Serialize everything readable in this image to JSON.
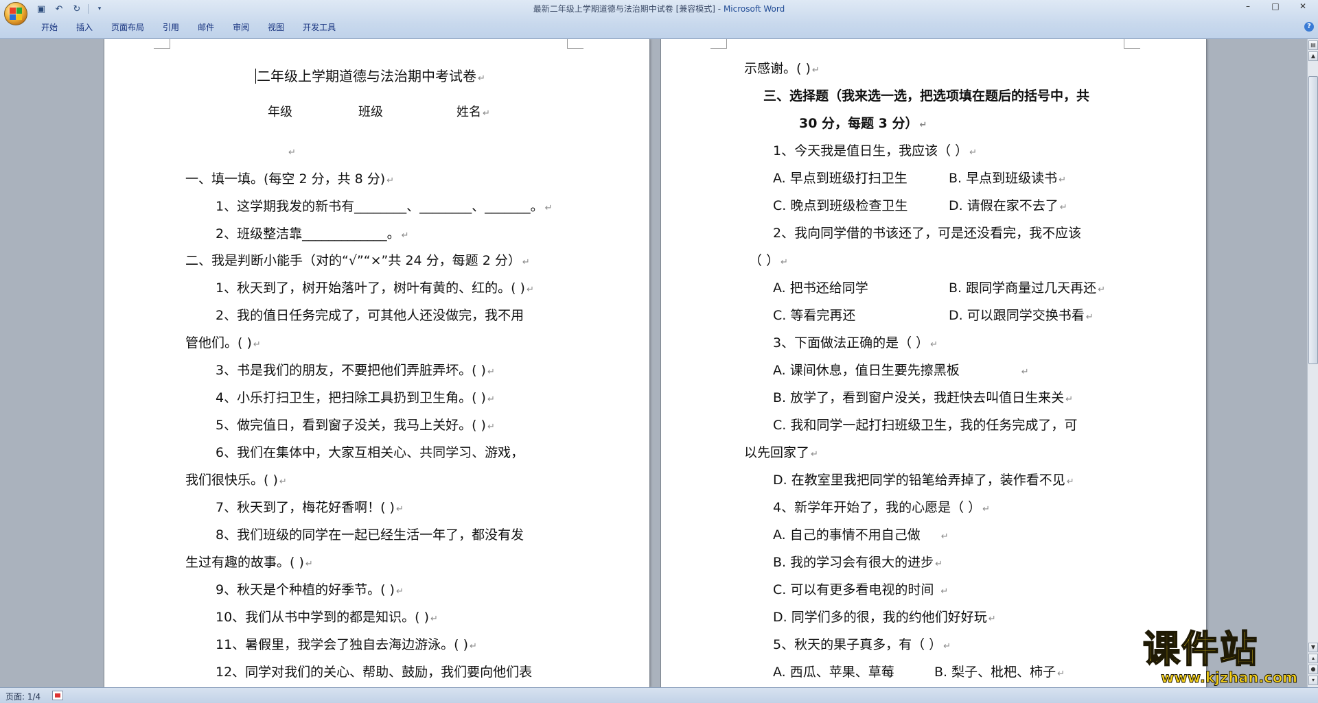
{
  "window": {
    "title_doc": "最新二年级上学期道德与法治期中试卷 [兼容模式]",
    "title_sep": " - ",
    "title_app": "Microsoft Word"
  },
  "ribbon_tabs": [
    "开始",
    "插入",
    "页面布局",
    "引用",
    "邮件",
    "审阅",
    "视图",
    "开发工具"
  ],
  "left_page": {
    "title": "二年级上学期道德与法治期中考试卷",
    "info": {
      "grade": "年级",
      "class": "班级",
      "name": "姓名"
    },
    "section1_title": "一、填一填。(每空 2 分，共 8 分)",
    "q1_1": "1、这学期我发的新书有________、________、_______。",
    "q1_2": "2、班级整洁靠_____________。",
    "section2_title": "二、我是判断小能手（对的“√”“×”共 24 分，每题 2 分）",
    "j1": "1、秋天到了，树开始落叶了，树叶有黄的、红的。(    )",
    "j2a": "2、我的值日任务完成了，可其他人还没做完，我不用",
    "j2b": "管他们。(    )",
    "j3": "3、书是我们的朋友，不要把他们弄脏弄坏。(    )",
    "j4": "4、小乐打扫卫生，把扫除工具扔到卫生角。(    )",
    "j5": "5、做完值日，看到窗子没关，我马上关好。(    )",
    "j6a": "6、我们在集体中，大家互相关心、共同学习、游戏，",
    "j6b": "我们很快乐。(    )",
    "j7": "7、秋天到了，梅花好香啊！(    )",
    "j8a": "8、我们班级的同学在一起已经生活一年了，都没有发",
    "j8b": "生过有趣的故事。(    )",
    "j9": "9、秋天是个种植的好季节。(    )",
    "j10": "10、我们从书中学到的都是知识。(    )",
    "j11": "11、暑假里，我学会了独自去海边游泳。(    )",
    "j12": "12、同学对我们的关心、帮助、鼓励，我们要向他们表"
  },
  "right_page": {
    "cont": "示感谢。(    )",
    "s3_a": "三、选择题（我来选一选，把选项填在题后的括号中，共",
    "s3_b": "30 分，每题 3 分）",
    "c1": "1、今天我是值日生，我应该（         ）",
    "c1_A": "A. 早点到班级打扫卫生",
    "c1_B": "B. 早点到班级读书",
    "c1_C": "C. 晚点到班级检查卫生",
    "c1_D": "D. 请假在家不去了",
    "c2a": "2、我向同学借的书该还了，可是还没看完，我不应该",
    "c2b": "（          ）",
    "c2_A": "A. 把书还给同学",
    "c2_B": "B. 跟同学商量过几天再还",
    "c2_C": "C. 等看完再还",
    "c2_D": "D. 可以跟同学交换书看",
    "c3": "3、下面做法正确的是（          ）",
    "c3_A": "A. 课间休息，值日生要先擦黑板",
    "c3_B": "B. 放学了，看到窗户没关，我赶快去叫值日生来关",
    "c3_Ca": "C. 我和同学一起打扫班级卫生，我的任务完成了，可",
    "c3_Cb": "以先回家了",
    "c3_D": "D. 在教室里我把同学的铅笔给弄掉了，装作看不见",
    "c4": "4、新学年开始了，我的心愿是（          ）",
    "c4_A": "A. 自己的事情不用自己做",
    "c4_B": "B. 我的学习会有很大的进步",
    "c4_C": "C. 可以有更多看电视的时间",
    "c4_D": "D. 同学们多的很，我的约他们好好玩",
    "c5": "5、秋天的果子真多，有（          ）",
    "c5_A": "A. 西瓜、苹果、草莓",
    "c5_B": "B. 梨子、枇杷、柿子"
  },
  "status": {
    "page": "页面: 1/4"
  },
  "watermark": {
    "brand": "课件站",
    "url": "www.kjzhan.com"
  },
  "colors": {
    "ribbon_bg": "#c9d9ed",
    "doc_bg": "#aab2bd",
    "watermark": "#f7d21a"
  }
}
